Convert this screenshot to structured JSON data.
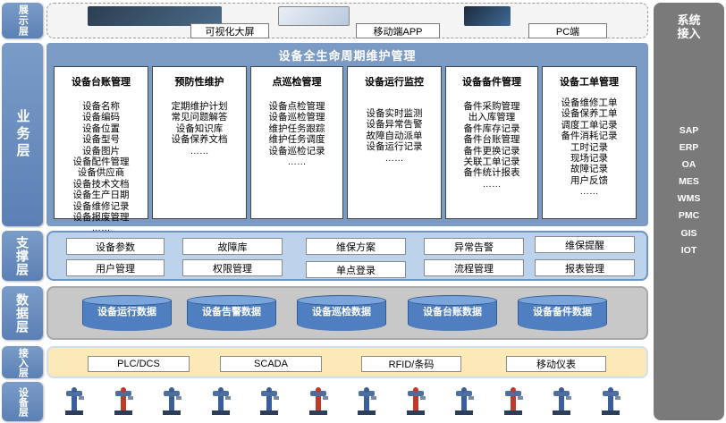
{
  "layers": {
    "display": "展示层",
    "business": "业务层",
    "support": "支撑层",
    "data": "数据层",
    "access": "接入层",
    "device": "设备层"
  },
  "display": {
    "items": [
      "可视化大屏",
      "移动端APP",
      "PC端"
    ]
  },
  "business": {
    "title": "设备全生命周期维护管理",
    "columns": [
      {
        "title": "设备台账管理",
        "items": [
          "设备名称",
          "设备编码",
          "设备位置",
          "设备型号",
          "设备图片",
          "设备配件管理",
          "设备供应商",
          "设备技术文档",
          "设备生产日期",
          "设备维修记录",
          "设备报废管理",
          "……"
        ]
      },
      {
        "title": "预防性维护",
        "items": [
          "定期维护计划",
          "常见问题解答",
          "设备知识库",
          "设备保养文档",
          "……"
        ]
      },
      {
        "title": "点巡检管理",
        "items": [
          "设备点检管理",
          "设备巡检管理",
          "维护任务跟踪",
          "维护任务调度",
          "设备巡检记录",
          "……"
        ]
      },
      {
        "title": "设备运行监控",
        "items": [
          "设备实时监测",
          "设备异常告警",
          "故障自动派单",
          "设备运行记录",
          "……"
        ]
      },
      {
        "title": "设备备件管理",
        "items": [
          "备件采购管理",
          "出入库管理",
          "备件库存记录",
          "备件台账管理",
          "备件更换记录",
          "关联工单记录",
          "备件统计报表",
          "……"
        ]
      },
      {
        "title": "设备工单管理",
        "items": [
          "设备维修工单",
          "设备保养工单",
          "调度工单记录",
          "备件消耗记录",
          "工时记录",
          "现场记录",
          "故障记录",
          "用户反馈",
          "……"
        ]
      }
    ]
  },
  "support": {
    "row1": [
      "设备参数",
      "故障库",
      "维保方案",
      "异常告警",
      "维保提醒"
    ],
    "row2": [
      "用户管理",
      "权限管理",
      "单点登录",
      "流程管理",
      "报表管理"
    ]
  },
  "data": {
    "stores": [
      "设备运行数据",
      "设备告警数据",
      "设备巡检数据",
      "设备台账数据",
      "设备备件数据"
    ]
  },
  "access": {
    "items": [
      "PLC/DCS",
      "SCADA",
      "RFID/条码",
      "移动仪表"
    ]
  },
  "system": {
    "title": "系统接入",
    "items": [
      "SAP",
      "ERP",
      "OA",
      "MES",
      "WMS",
      "PMC",
      "GIS",
      "IOT"
    ]
  },
  "colors": {
    "label_bg": "#6b8ec1",
    "business_bg": "#7b9bc4",
    "support_bg": "#bdd3ec",
    "data_bg": "#c8c8c8",
    "access_bg": "#fbe9b8",
    "cylinder": "#4f7fc0",
    "system_bg": "#7a7a7a"
  }
}
